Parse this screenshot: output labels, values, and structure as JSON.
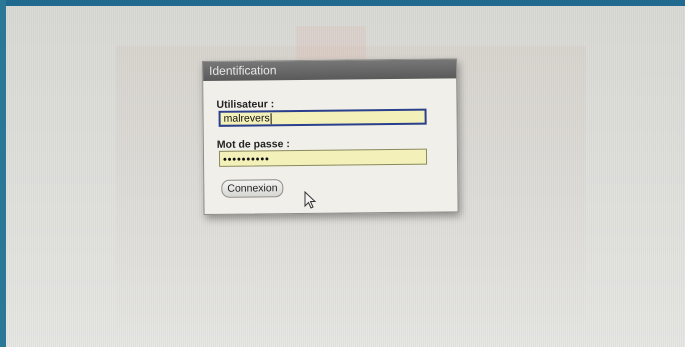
{
  "dialog": {
    "title": "Identification",
    "username_label": "Utilisateur :",
    "username_value": "malrevers",
    "password_label": "Mot de passe :",
    "password_value": "••••••••••",
    "submit_label": "Connexion"
  },
  "colors": {
    "field_bg": "#f3f1b9",
    "titlebar": "#666666",
    "focus_border": "#2b3f8f"
  },
  "icons": [
    "mouse-pointer-icon"
  ]
}
